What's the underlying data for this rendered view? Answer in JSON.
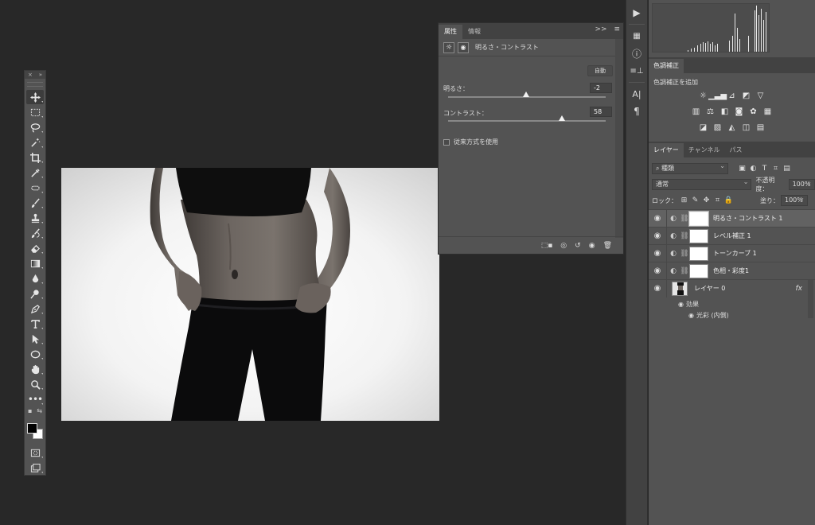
{
  "toolbar": {
    "close_glyph": "×",
    "collapse_glyph": "»",
    "tools": [
      {
        "name": "move-tool",
        "selected": true
      },
      {
        "name": "marquee-tool"
      },
      {
        "name": "lasso-tool"
      },
      {
        "name": "magic-wand-tool"
      },
      {
        "name": "crop-tool"
      },
      {
        "name": "eyedropper-tool"
      },
      {
        "name": "healing-brush-tool"
      },
      {
        "name": "brush-tool"
      },
      {
        "name": "clone-stamp-tool"
      },
      {
        "name": "history-brush-tool"
      },
      {
        "name": "eraser-tool"
      },
      {
        "name": "gradient-tool"
      },
      {
        "name": "blur-tool"
      },
      {
        "name": "dodge-tool"
      },
      {
        "name": "pen-tool"
      },
      {
        "name": "type-tool"
      },
      {
        "name": "path-selection-tool"
      },
      {
        "name": "ellipse-tool"
      },
      {
        "name": "hand-tool"
      },
      {
        "name": "zoom-tool"
      },
      {
        "name": "more-tools"
      }
    ],
    "foreground_color": "#000000",
    "background_color": "#ffffff"
  },
  "properties": {
    "tab_properties": "属性",
    "tab_info": "情報",
    "expand_glyph": ">>",
    "menu_glyph": "≡",
    "header_title": "明るさ・コントラスト",
    "auto_label": "自動",
    "brightness_label": "明るさ：",
    "brightness_value": "-2",
    "brightness_min": -150,
    "brightness_max": 150,
    "contrast_label": "コントラスト：",
    "contrast_value": "58",
    "contrast_min": -50,
    "contrast_max": 100,
    "legacy_label": "従来方式を使用"
  },
  "adjustments": {
    "tab_label": "色調補正",
    "add_label": "色調補正を追加"
  },
  "layers": {
    "tab_layers": "レイヤー",
    "tab_channels": "チャンネル",
    "tab_paths": "パス",
    "filter_kind": "種類",
    "blend_mode": "通常",
    "opacity_label": "不透明度：",
    "opacity_value": "100%",
    "lock_label": "ロック：",
    "fill_label": "塗り：",
    "fill_value": "100%",
    "items": [
      {
        "name": "明るさ・コントラスト 1",
        "selected": true
      },
      {
        "name": "レベル補正 1"
      },
      {
        "name": "トーンカーブ 1"
      },
      {
        "name": "色相・彩度1"
      }
    ],
    "base_layer": "レイヤー 0",
    "fx_label": "fx",
    "effects_label": "効果",
    "inner_glow_label": "光彩 (内側)"
  }
}
